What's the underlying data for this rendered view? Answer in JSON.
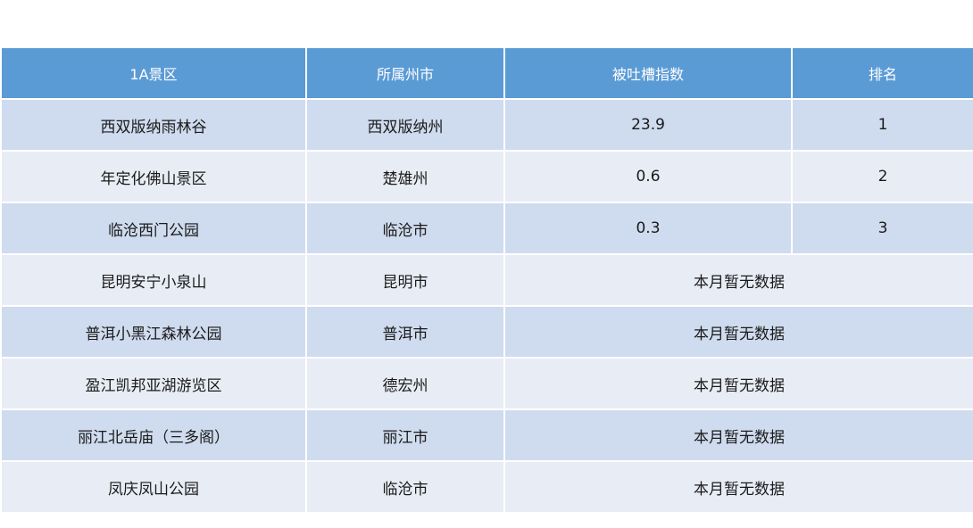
{
  "headers": [
    "1A景区",
    "所属州市",
    "被吐槽指数",
    "排名"
  ],
  "rows": [
    {
      "scenic": "西双版纳雨林谷",
      "city": "西双版纳州",
      "index": "23.9",
      "rank": "1"
    },
    {
      "scenic": "年定化佛山景区",
      "city": "楚雄州",
      "index": "0.6",
      "rank": "2"
    },
    {
      "scenic": "临沧西门公园",
      "city": "临沧市",
      "index": "0.3",
      "rank": "3"
    },
    {
      "scenic": "昆明安宁小泉山",
      "city": "昆明市",
      "nodata": "本月暂无数据"
    },
    {
      "scenic": "普洱小黑江森林公园",
      "city": "普洱市",
      "nodata": "本月暂无数据"
    },
    {
      "scenic": "盈江凯邦亚湖游览区",
      "city": "德宏州",
      "nodata": "本月暂无数据"
    },
    {
      "scenic": "丽江北岳庙（三多阁）",
      "city": "丽江市",
      "nodata": "本月暂无数据"
    },
    {
      "scenic": "凤庆凤山公园",
      "city": "临沧市",
      "nodata": "本月暂无数据"
    }
  ],
  "colors": {
    "header_bg": "#5b9bd5",
    "row_dark": "#cfdbee",
    "row_light": "#e8edf5"
  }
}
